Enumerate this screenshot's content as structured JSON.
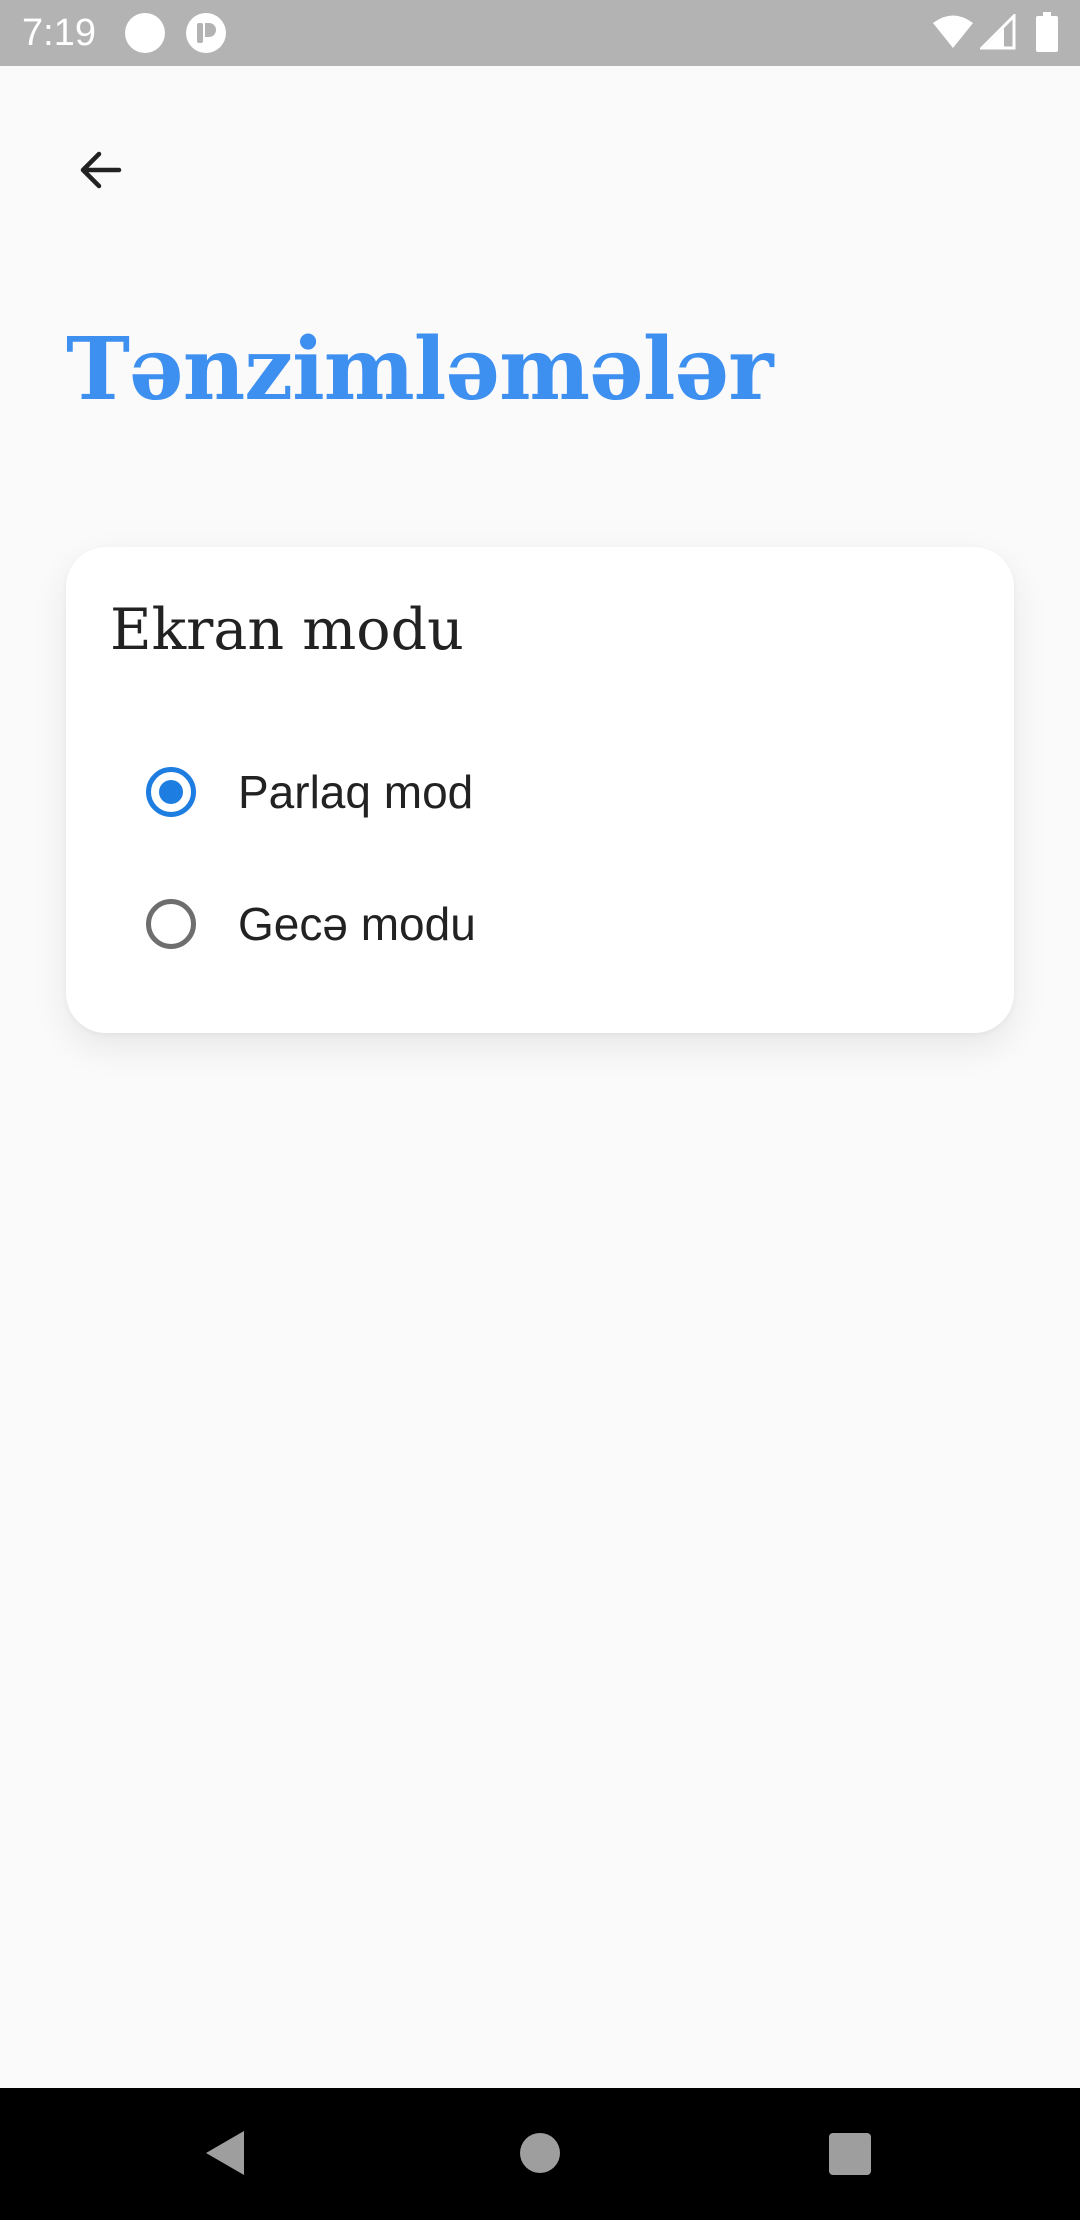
{
  "status_bar": {
    "time": "7:19",
    "icons": [
      "notification-dot-icon",
      "app-notification-icon",
      "wifi-icon",
      "signal-icon",
      "battery-icon"
    ]
  },
  "header": {
    "back_icon": "arrow-back-icon",
    "title": "Tənzimləmələr"
  },
  "display_mode_card": {
    "title": "Ekran modu",
    "options": [
      {
        "label": "Parlaq mod",
        "selected": true
      },
      {
        "label": "Gecə modu",
        "selected": false
      }
    ]
  },
  "nav_bar": {
    "icons": [
      "nav-back-icon",
      "nav-home-icon",
      "nav-recents-icon"
    ]
  },
  "colors": {
    "accent": "#3d8ff0",
    "radio_selected": "#1e7de0",
    "status_bar": "#b3b3b3",
    "background": "#fafafa"
  }
}
